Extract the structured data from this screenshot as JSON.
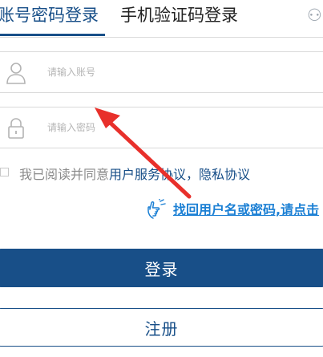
{
  "tabs": {
    "account_login": "账号密码登录",
    "sms_login": "手机验证码登录",
    "qr_icon": "qrcode-icon",
    "qr_glyph": "⚇"
  },
  "form": {
    "account_placeholder": "请输入账号",
    "password_placeholder": "请输入密码",
    "account_icon": "user-icon",
    "password_icon": "lock-icon"
  },
  "agreement": {
    "prefix": "我已阅读并同意",
    "service_agreement": "用户服务协议",
    "separator": "，",
    "privacy_agreement": "隐私协议"
  },
  "recover": {
    "icon": "pointing-hand-icon",
    "link_text": "找回用户名或密码,请点击"
  },
  "buttons": {
    "login": "登录",
    "register": "注册"
  },
  "annotation": {
    "icon": "red-arrow-annotation",
    "color": "#e8302b"
  },
  "colors": {
    "brand": "#184f88",
    "link": "#1a7fd4"
  }
}
